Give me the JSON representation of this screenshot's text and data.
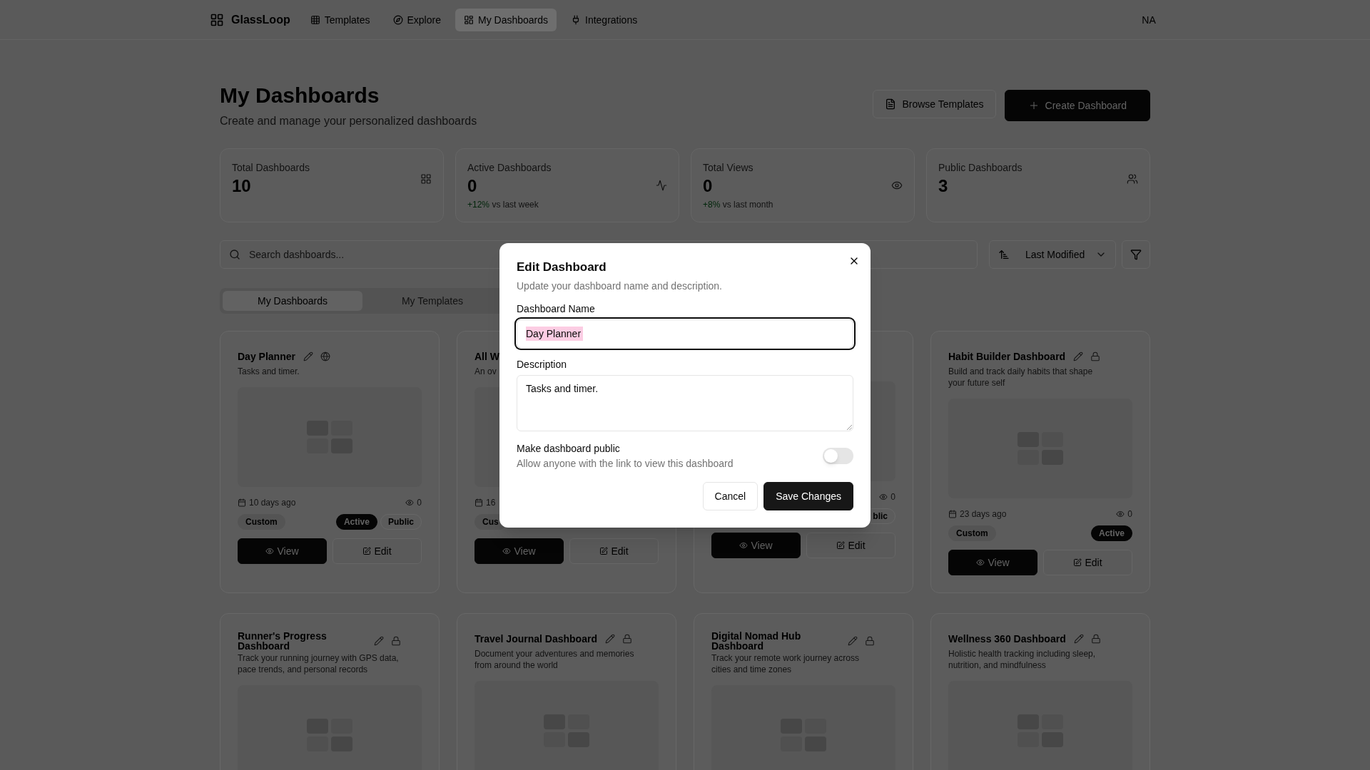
{
  "nav": {
    "brand": "GlassLoop",
    "items": [
      {
        "label": "Templates",
        "selected": false
      },
      {
        "label": "Explore",
        "selected": false
      },
      {
        "label": "My Dashboards",
        "selected": true
      },
      {
        "label": "Integrations",
        "selected": false
      }
    ],
    "user_initials": "NA"
  },
  "header": {
    "title": "My Dashboards",
    "subtitle": "Create and manage your personalized dashboards",
    "buttons": [
      {
        "label": "Browse Templates",
        "kind": "outline"
      },
      {
        "label": "Create Dashboard",
        "kind": "primary"
      }
    ]
  },
  "stats": [
    {
      "label": "Total Dashboards",
      "value": "10"
    },
    {
      "label": "Active Dashboards",
      "value": "0",
      "change": {
        "value": "+12%",
        "note": "vs last week"
      }
    },
    {
      "label": "Total Views",
      "value": "0",
      "change": {
        "value": "+8%",
        "note": "vs last month"
      }
    },
    {
      "label": "Public Dashboards",
      "value": "3"
    }
  ],
  "toolbar": {
    "search": {
      "placeholder": "Search dashboards..."
    },
    "sort": {
      "value": "Last Modified"
    }
  },
  "tabs": [
    {
      "label": "My Dashboards",
      "selected": true
    },
    {
      "label": "My Templates",
      "selected": false
    }
  ],
  "dashboards": [
    {
      "title": "Day Planner",
      "description": "Tasks and timer.",
      "public": true,
      "updated": "10 days ago",
      "views": "0",
      "badges": [
        {
          "label": "Custom",
          "kind": "muted"
        },
        {
          "label": "Active",
          "kind": "solid"
        },
        {
          "label": "Public",
          "kind": "outline"
        }
      ],
      "buttons": [
        {
          "label": "View",
          "kind": "primary"
        },
        {
          "label": "Edit",
          "kind": "outline"
        }
      ]
    },
    {
      "title": "All W",
      "description": "An ov",
      "updated": "16",
      "badges": [
        {
          "label": "Cus",
          "kind": "muted"
        }
      ],
      "buttons": [
        {
          "label": "View",
          "kind": "primary"
        },
        {
          "label": "Edit",
          "kind": "outline"
        }
      ]
    },
    {
      "views": "0",
      "badges": [
        {
          "label": "blic",
          "kind": "outline"
        }
      ],
      "buttons": [
        {
          "label": "View",
          "kind": "primary"
        },
        {
          "label": "Edit",
          "kind": "outline"
        }
      ]
    },
    {
      "title": "Habit Builder Dashboard",
      "description": "Build and track daily habits that shape your future self",
      "public": false,
      "updated": "23 days ago",
      "views": "0",
      "badges": [
        {
          "label": "Custom",
          "kind": "muted"
        },
        {
          "label": "Active",
          "kind": "solid"
        }
      ],
      "buttons": [
        {
          "label": "View",
          "kind": "primary"
        },
        {
          "label": "Edit",
          "kind": "outline"
        }
      ]
    },
    {
      "title": "Runner's Progress Dashboard",
      "description": "Track your running journey with GPS data, pace trends, and personal records",
      "public": false
    },
    {
      "title": "Travel Journal Dashboard",
      "description": "Document your adventures and memories from around the world",
      "public": false
    },
    {
      "title": "Digital Nomad Hub Dashboard",
      "description": "Track your remote work journey across cities and time zones",
      "public": false
    },
    {
      "title": "Wellness 360 Dashboard",
      "description": "Holistic health tracking including sleep, nutrition, and mindfulness",
      "public": false
    }
  ],
  "dialog": {
    "title": "Edit Dashboard",
    "description": "Update your dashboard name and description.",
    "fields": [
      {
        "kind": "input",
        "label": "Dashboard Name",
        "value": "Day Planner",
        "focused": true,
        "text_highlighted": true
      },
      {
        "kind": "textarea",
        "label": "Description",
        "value": "Tasks and timer.",
        "focused": false,
        "text_highlighted": false
      }
    ],
    "toggle": {
      "label": "Make dashboard public",
      "hint": "Allow anyone with the link to view this dashboard",
      "on": false
    },
    "buttons": [
      {
        "label": "Cancel",
        "kind": "outline"
      },
      {
        "label": "Save Changes",
        "kind": "primary"
      }
    ]
  }
}
